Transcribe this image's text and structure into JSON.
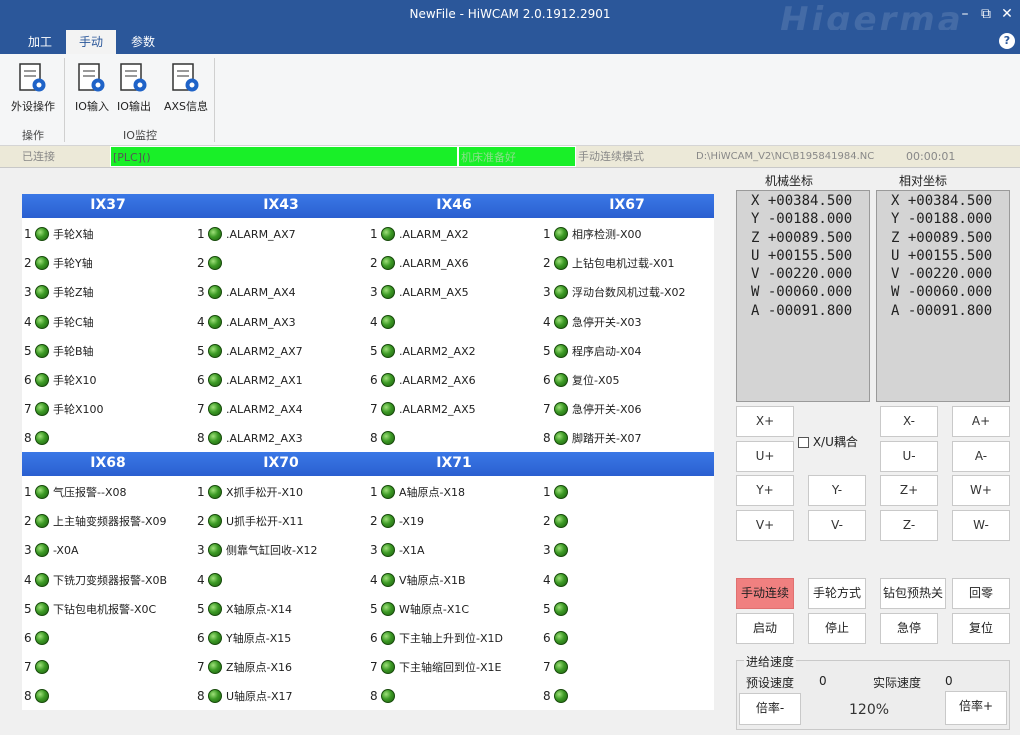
{
  "window": {
    "title": "NewFile - HiWCAM 2.0.1912.2901",
    "watermark": "Higerma",
    "minimize": "–",
    "restore": "⧉",
    "close": "✕"
  },
  "tabs": [
    {
      "label": "加工"
    },
    {
      "label": "手动"
    },
    {
      "label": "参数"
    }
  ],
  "help": "?",
  "ribbon": {
    "buttons": [
      {
        "label": "外设操作"
      },
      {
        "label": "IO输入"
      },
      {
        "label": "IO输出"
      },
      {
        "label": "AXS信息"
      }
    ],
    "groups": [
      {
        "label": "操作"
      },
      {
        "label": "IO监控"
      }
    ]
  },
  "status": {
    "connection": "已连接",
    "plc": "[PLC]()",
    "ready": "机床准备好",
    "mode": "手动连续模式",
    "file": "D:\\HiWCAM_V2\\NC\\B195841984.NC",
    "time": "00:00:01"
  },
  "io_top": {
    "headers": [
      "IX37",
      "IX43",
      "IX46",
      "IX67"
    ],
    "rows": [
      [
        "手轮X轴",
        "手轮Y轴",
        "手轮Z轴",
        "手轮C轴",
        "手轮B轴",
        "手轮X10",
        "手轮X100",
        ""
      ],
      [
        ".ALARM_AX7",
        "",
        ".ALARM_AX4",
        ".ALARM_AX3",
        ".ALARM2_AX7",
        ".ALARM2_AX1",
        ".ALARM2_AX4",
        ".ALARM2_AX3"
      ],
      [
        ".ALARM_AX2",
        ".ALARM_AX6",
        ".ALARM_AX5",
        "",
        ".ALARM2_AX2",
        ".ALARM2_AX6",
        ".ALARM2_AX5",
        ""
      ],
      [
        "相序检测-X00",
        "上钻包电机过载-X01",
        "浮动台数风机过载-X02",
        "急停开关-X03",
        "程序启动-X04",
        "复位-X05",
        "急停开关-X06",
        "脚踏开关-X07"
      ]
    ]
  },
  "io_bottom": {
    "headers": [
      "IX68",
      "IX70",
      "IX71",
      ""
    ],
    "rows": [
      [
        "气压报警--X08",
        "上主轴变频器报警-X09",
        "-X0A",
        "下铣刀变频器报警-X0B",
        "下钻包电机报警-X0C",
        "",
        "",
        ""
      ],
      [
        "X抓手松开-X10",
        "U抓手松开-X11",
        "侧靠气缸回收-X12",
        "",
        "X轴原点-X14",
        "Y轴原点-X15",
        "Z轴原点-X16",
        "U轴原点-X17"
      ],
      [
        "A轴原点-X18",
        "-X19",
        "-X1A",
        "V轴原点-X1B",
        "W轴原点-X1C",
        "下主轴上升到位-X1D",
        "下主轴缩回到位-X1E",
        ""
      ],
      [
        "",
        "",
        "",
        "",
        "",
        "",
        "",
        ""
      ]
    ]
  },
  "coords": {
    "machine_label": "机械坐标",
    "relative_label": "相对坐标",
    "machine": [
      "X +00384.500",
      "Y -00188.000",
      "Z +00089.500",
      "U +00155.500",
      "V -00220.000",
      "W -00060.000",
      "A -00091.800"
    ],
    "relative": [
      "X +00384.500",
      "Y -00188.000",
      "Z +00089.500",
      "U +00155.500",
      "V -00220.000",
      "W -00060.000",
      "A -00091.800"
    ]
  },
  "jog": {
    "xp": "X+",
    "xm": "X-",
    "ap": "A+",
    "up": "U+",
    "um": "U-",
    "am": "A-",
    "yp": "Y+",
    "ym": "Y-",
    "zp": "Z+",
    "wp": "W+",
    "vp": "V+",
    "vm": "V-",
    "zm": "Z-",
    "wm": "W-",
    "couple_label": "X/U耦合"
  },
  "functions": {
    "manual_cont": "手动连续",
    "handwheel": "手轮方式",
    "drill_preheat": "钻包预热关",
    "home": "回零",
    "start": "启动",
    "stop": "停止",
    "estop": "急停",
    "reset": "复位"
  },
  "feed": {
    "title": "进给速度",
    "preset_label": "预设速度",
    "preset_value": "0",
    "actual_label": "实际速度",
    "actual_value": "0",
    "rate_minus": "倍率-",
    "rate_plus": "倍率+",
    "rate": "120%"
  },
  "colors": {
    "title_bar": "#2b579a",
    "active_green": "#19ef28",
    "header_blue": "#2a5fd0",
    "manual_active": "#f08080"
  }
}
